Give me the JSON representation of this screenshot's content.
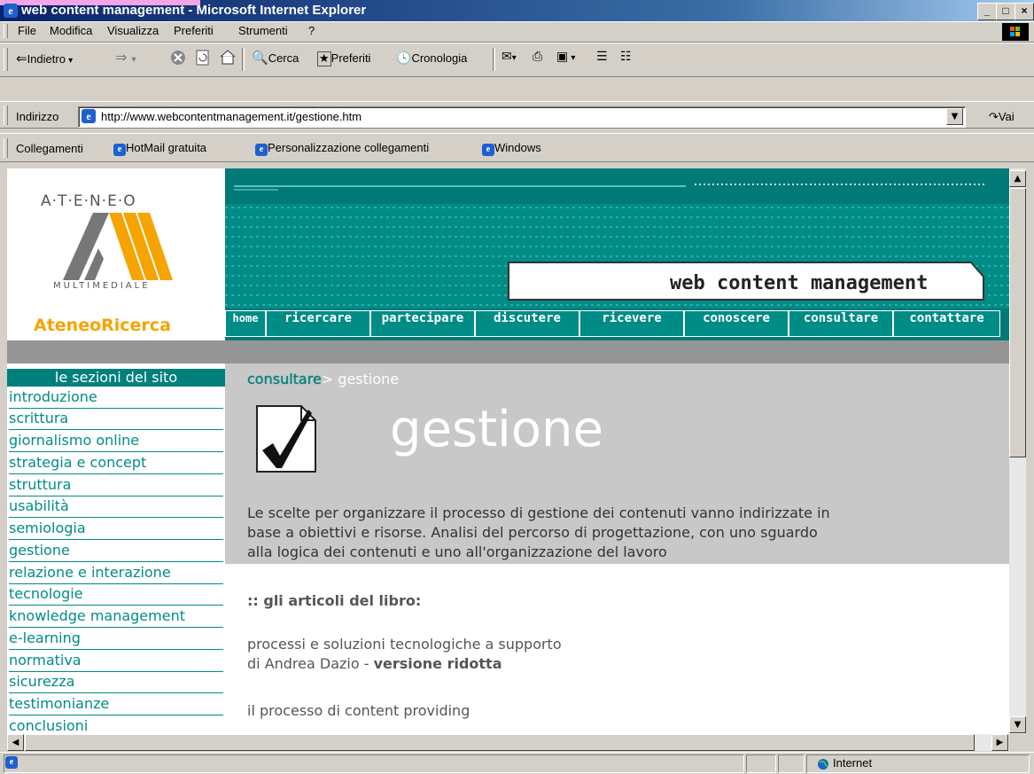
{
  "window": {
    "title": "web content management - Microsoft Internet Explorer"
  },
  "menu": [
    "File",
    "Modifica",
    "Visualizza",
    "Preferiti",
    "Strumenti",
    "?"
  ],
  "toolbar": {
    "back": "Indietro",
    "search": "Cerca",
    "favorites": "Preferiti",
    "history": "Cronologia"
  },
  "address": {
    "label": "Indirizzo",
    "url": "http://www.webcontentmanagement.it/gestione.htm",
    "go": "Vai"
  },
  "links": {
    "label": "Collegamenti",
    "items": [
      "HotMail gratuita",
      "Personalizzazione collegamenti",
      "Windows"
    ]
  },
  "site": {
    "logo_top": "A·T·E·N·E·O",
    "logo_bottom": "MULTIMEDIALE",
    "brand": "AteneoRicerca",
    "banner": "web content management",
    "nav": [
      "home",
      "ricercare",
      "partecipare",
      "discutere",
      "ricevere",
      "conoscere",
      "consultare",
      "contattare"
    ],
    "sidebar_title": "le sezioni del sito",
    "sidebar_items": [
      "introduzione",
      "scrittura",
      "giornalismo online",
      "strategia e concept",
      "struttura",
      "usabilità",
      "semiologia",
      "gestione",
      "relazione e interazione",
      "tecnologie",
      "knowledge management",
      "e-learning",
      "normativa",
      "sicurezza",
      "testimonianze",
      "conclusioni"
    ],
    "breadcrumb_link": "consultare",
    "breadcrumb_current": "> gestione",
    "page_title": "gestione",
    "intro_lines": [
      "Le scelte per organizzare il processo di gestione dei contenuti vanno indirizzate in",
      "base a obiettivi e risorse. Analisi del percorso di progettazione, con uno sguardo",
      "alla logica dei contenuti e uno all'organizzazione del lavoro"
    ],
    "articles_heading": ":: gli articoli del libro:",
    "article1_title": "processi e soluzioni tecnologiche a supporto",
    "article1_author": "di Andrea Dazio - ",
    "article1_version": "versione ridotta",
    "article2_title": "il processo di content providing"
  },
  "status": {
    "zone": "Internet"
  },
  "colors": {
    "teal": "#007a77",
    "teal_link": "#008c86",
    "orange": "#f5a400"
  }
}
